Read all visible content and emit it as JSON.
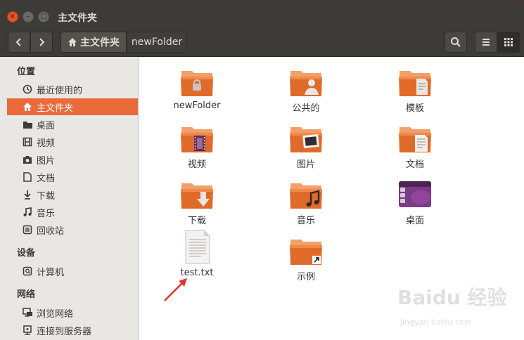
{
  "window": {
    "title": "主文件夹",
    "controls": {
      "close": "×",
      "minimize": "–",
      "maximize": "□"
    }
  },
  "toolbar": {
    "back_icon": "chevron-left-icon",
    "forward_icon": "chevron-right-icon",
    "breadcrumb": {
      "home_label": "主文件夹",
      "current_label": "newFolder"
    },
    "search_icon": "search-icon",
    "list_view_icon": "list-view-icon",
    "grid_view_icon": "grid-view-icon"
  },
  "sidebar": {
    "sections": [
      {
        "heading": "位置"
      },
      {
        "heading": "设备"
      },
      {
        "heading": "网络"
      }
    ],
    "places": [
      {
        "label": "最近使用的",
        "icon": "clock-icon"
      },
      {
        "label": "主文件夹",
        "icon": "home-icon",
        "selected": true
      },
      {
        "label": "桌面",
        "icon": "desktop-folder-icon"
      },
      {
        "label": "视频",
        "icon": "film-icon"
      },
      {
        "label": "图片",
        "icon": "camera-icon"
      },
      {
        "label": "文档",
        "icon": "document-icon"
      },
      {
        "label": "下载",
        "icon": "download-icon"
      },
      {
        "label": "音乐",
        "icon": "music-icon"
      },
      {
        "label": "回收站",
        "icon": "trash-icon"
      }
    ],
    "devices": [
      {
        "label": "计算机",
        "icon": "computer-icon"
      }
    ],
    "network": [
      {
        "label": "浏览网络",
        "icon": "network-icon"
      },
      {
        "label": "连接到服务器",
        "icon": "server-icon"
      }
    ]
  },
  "files": [
    {
      "name": "newFolder",
      "icon": "locked-folder-icon"
    },
    {
      "name": "公共的",
      "icon": "public-folder-icon"
    },
    {
      "name": "模板",
      "icon": "templates-folder-icon"
    },
    {
      "name": "视频",
      "icon": "videos-folder-icon"
    },
    {
      "name": "图片",
      "icon": "pictures-folder-icon"
    },
    {
      "name": "文档",
      "icon": "documents-folder-icon"
    },
    {
      "name": "下载",
      "icon": "downloads-folder-icon"
    },
    {
      "name": "音乐",
      "icon": "music-folder-icon"
    },
    {
      "name": "桌面",
      "icon": "desktop-folder-icon"
    },
    {
      "name": "test.txt",
      "icon": "text-file-icon"
    },
    {
      "name": "示例",
      "icon": "examples-folder-icon"
    }
  ],
  "watermark": {
    "text": "Baidu 经验",
    "url": "jingyan.baidu.com"
  },
  "colors": {
    "accent": "#e95420",
    "selection": "#ea6a3a",
    "titlebar": "#3c3b37",
    "folder_top": "#f0a068",
    "folder_body": "#e06a2a",
    "annotation_arrow": "#e8302a"
  }
}
